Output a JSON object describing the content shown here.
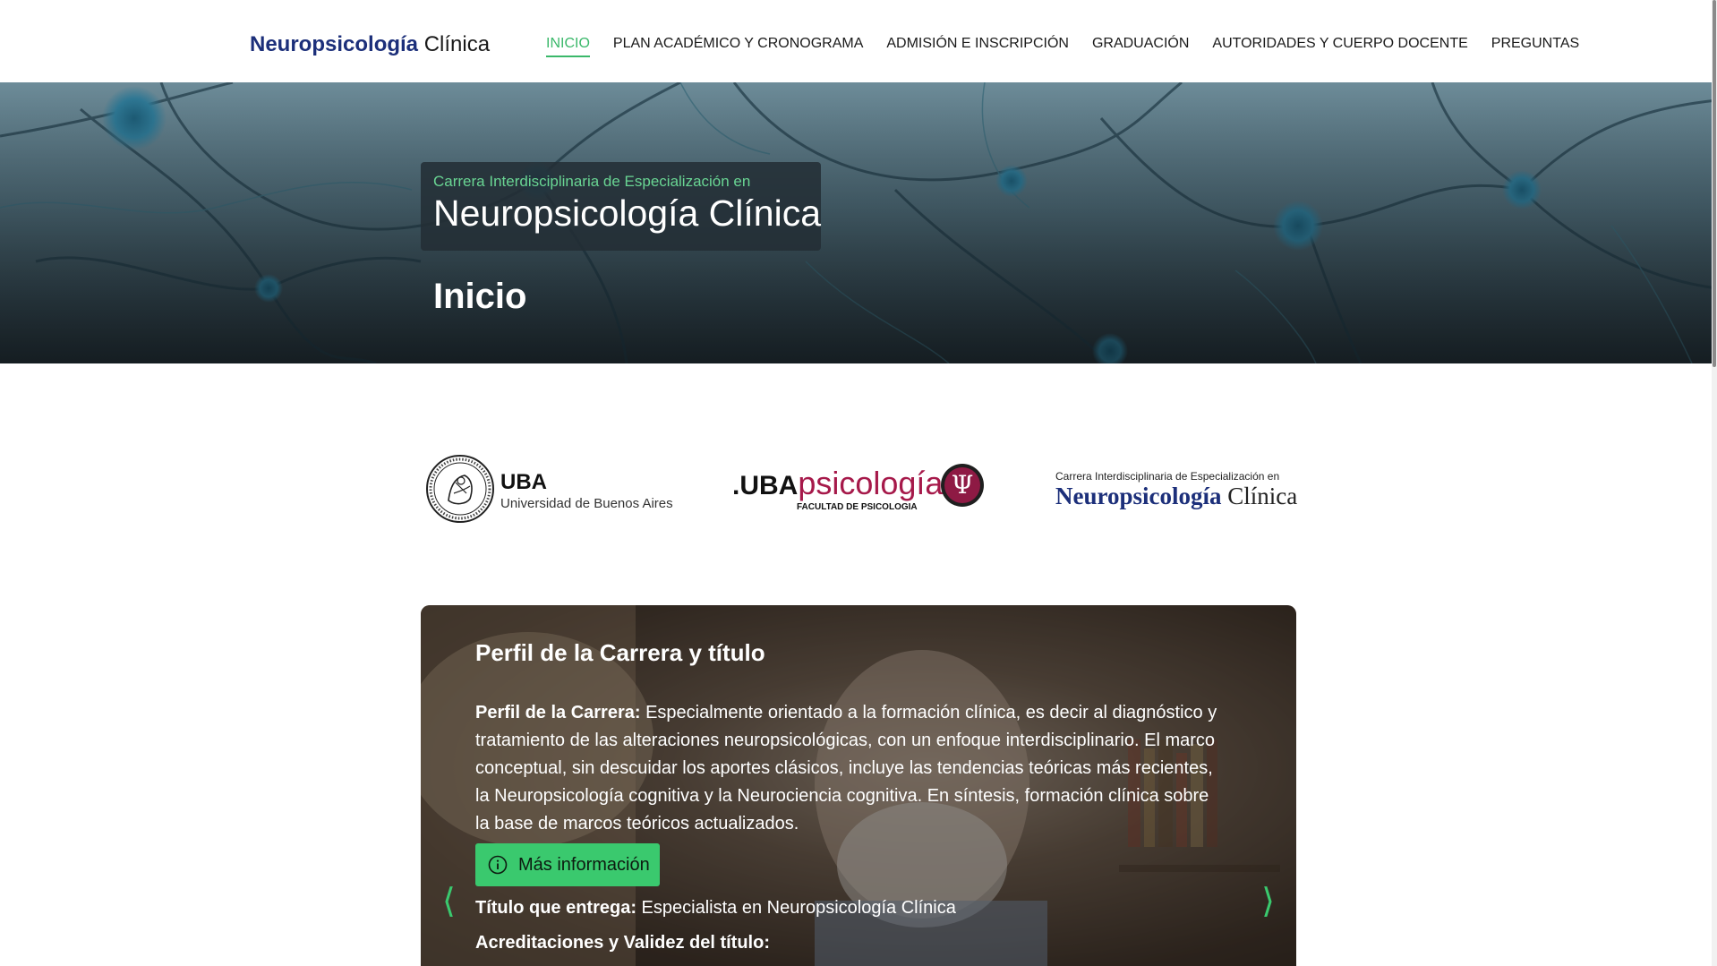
{
  "header": {
    "brand_bold": "Neuropsicología",
    "brand_light": " Clínica",
    "nav": [
      {
        "label": "INICIO",
        "active": true
      },
      {
        "label": "PLAN ACADÉMICO Y CRONOGRAMA"
      },
      {
        "label": "ADMISIÓN E INSCRIPCIÓN"
      },
      {
        "label": "GRADUACIÓN"
      },
      {
        "label": "AUTORIDADES Y CUERPO DOCENTE"
      },
      {
        "label": "PREGUNTAS"
      }
    ]
  },
  "hero": {
    "subtitle": "Carrera Interdisciplinaria de Especialización en",
    "title": "Neuropsicología Clínica",
    "page_title": "Inicio"
  },
  "logos": {
    "uba_big": "UBA",
    "uba_small": "Universidad de Buenos Aires",
    "psi_uba": ".UBA",
    "psi_word": "psicología",
    "psi_faculty": "FACULTAD DE PSICOLOGIA",
    "psi_symbol": "Ψ",
    "carrera_sub": "Carrera Interdisciplinaria de Especialización en",
    "carrera_bold": "Neuropsicología",
    "carrera_light": " Clínica"
  },
  "carousel": {
    "title": "Perfil de la Carrera y título",
    "perfil_label": "Perfil de la Carrera:",
    "perfil_text": " Especialmente orientado a la formación clínica, es decir al diagnóstico y tratamiento de las alteraciones neuropsicológicas, con un enfoque interdisciplinario. El marco conceptual, sin descuidar los aportes clásicos, incluye las tendencias teóricas más recientes, la Neuropsicología cognitiva y la Neurociencia cognitiva. En síntesis, formación clínica sobre la base de marcos teóricos actualizados.",
    "more_button": "Más información",
    "titulo_label": "Título que entrega:",
    "titulo_text": " Especialista en Neuropsicología Clínica",
    "acred_label": "Acreditaciones y Validez del título:",
    "prev_arrow": "⟨",
    "next_arrow": "⟩"
  },
  "colors": {
    "accent": "#3ac96e",
    "brand": "#1c2f7a",
    "psi_red": "#a6194a"
  }
}
